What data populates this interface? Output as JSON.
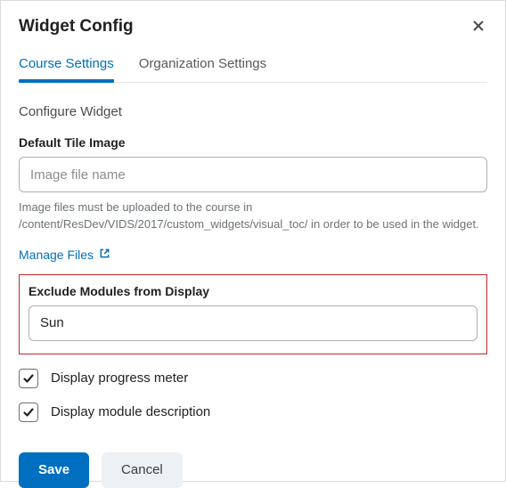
{
  "dialog": {
    "title": "Widget Config",
    "close_name": "close-icon"
  },
  "tabs": {
    "course": "Course Settings",
    "org": "Organization Settings"
  },
  "section": {
    "heading": "Configure Widget"
  },
  "default_tile": {
    "label": "Default Tile Image",
    "placeholder": "Image file name",
    "value": "",
    "help": "Image files must be uploaded to the course in /content/ResDev/VIDS/2017/custom_widgets/visual_toc/ in order to be used in the widget."
  },
  "manage_files": {
    "label": "Manage Files"
  },
  "exclude": {
    "label": "Exclude Modules from Display",
    "value": "Sun"
  },
  "checkboxes": {
    "progress": {
      "label": "Display progress meter",
      "checked": true
    },
    "description": {
      "label": "Display module description",
      "checked": true
    }
  },
  "footer": {
    "save": "Save",
    "cancel": "Cancel"
  }
}
